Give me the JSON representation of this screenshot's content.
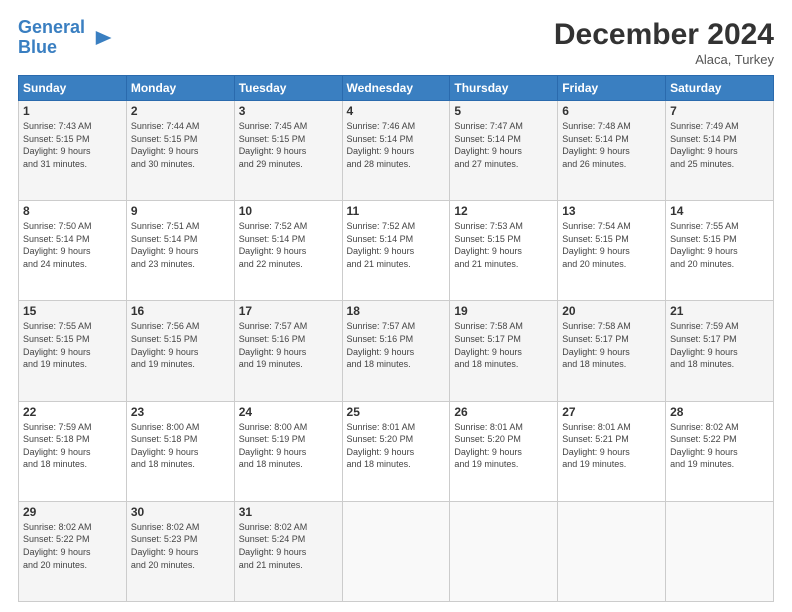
{
  "logo": {
    "line1": "General",
    "line2": "Blue"
  },
  "title": "December 2024",
  "location": "Alaca, Turkey",
  "days_header": [
    "Sunday",
    "Monday",
    "Tuesday",
    "Wednesday",
    "Thursday",
    "Friday",
    "Saturday"
  ],
  "weeks": [
    [
      {
        "day": "1",
        "content": "Sunrise: 7:43 AM\nSunset: 5:15 PM\nDaylight: 9 hours\nand 31 minutes."
      },
      {
        "day": "2",
        "content": "Sunrise: 7:44 AM\nSunset: 5:15 PM\nDaylight: 9 hours\nand 30 minutes."
      },
      {
        "day": "3",
        "content": "Sunrise: 7:45 AM\nSunset: 5:15 PM\nDaylight: 9 hours\nand 29 minutes."
      },
      {
        "day": "4",
        "content": "Sunrise: 7:46 AM\nSunset: 5:14 PM\nDaylight: 9 hours\nand 28 minutes."
      },
      {
        "day": "5",
        "content": "Sunrise: 7:47 AM\nSunset: 5:14 PM\nDaylight: 9 hours\nand 27 minutes."
      },
      {
        "day": "6",
        "content": "Sunrise: 7:48 AM\nSunset: 5:14 PM\nDaylight: 9 hours\nand 26 minutes."
      },
      {
        "day": "7",
        "content": "Sunrise: 7:49 AM\nSunset: 5:14 PM\nDaylight: 9 hours\nand 25 minutes."
      }
    ],
    [
      {
        "day": "8",
        "content": "Sunrise: 7:50 AM\nSunset: 5:14 PM\nDaylight: 9 hours\nand 24 minutes."
      },
      {
        "day": "9",
        "content": "Sunrise: 7:51 AM\nSunset: 5:14 PM\nDaylight: 9 hours\nand 23 minutes."
      },
      {
        "day": "10",
        "content": "Sunrise: 7:52 AM\nSunset: 5:14 PM\nDaylight: 9 hours\nand 22 minutes."
      },
      {
        "day": "11",
        "content": "Sunrise: 7:52 AM\nSunset: 5:14 PM\nDaylight: 9 hours\nand 21 minutes."
      },
      {
        "day": "12",
        "content": "Sunrise: 7:53 AM\nSunset: 5:15 PM\nDaylight: 9 hours\nand 21 minutes."
      },
      {
        "day": "13",
        "content": "Sunrise: 7:54 AM\nSunset: 5:15 PM\nDaylight: 9 hours\nand 20 minutes."
      },
      {
        "day": "14",
        "content": "Sunrise: 7:55 AM\nSunset: 5:15 PM\nDaylight: 9 hours\nand 20 minutes."
      }
    ],
    [
      {
        "day": "15",
        "content": "Sunrise: 7:55 AM\nSunset: 5:15 PM\nDaylight: 9 hours\nand 19 minutes."
      },
      {
        "day": "16",
        "content": "Sunrise: 7:56 AM\nSunset: 5:15 PM\nDaylight: 9 hours\nand 19 minutes."
      },
      {
        "day": "17",
        "content": "Sunrise: 7:57 AM\nSunset: 5:16 PM\nDaylight: 9 hours\nand 19 minutes."
      },
      {
        "day": "18",
        "content": "Sunrise: 7:57 AM\nSunset: 5:16 PM\nDaylight: 9 hours\nand 18 minutes."
      },
      {
        "day": "19",
        "content": "Sunrise: 7:58 AM\nSunset: 5:17 PM\nDaylight: 9 hours\nand 18 minutes."
      },
      {
        "day": "20",
        "content": "Sunrise: 7:58 AM\nSunset: 5:17 PM\nDaylight: 9 hours\nand 18 minutes."
      },
      {
        "day": "21",
        "content": "Sunrise: 7:59 AM\nSunset: 5:17 PM\nDaylight: 9 hours\nand 18 minutes."
      }
    ],
    [
      {
        "day": "22",
        "content": "Sunrise: 7:59 AM\nSunset: 5:18 PM\nDaylight: 9 hours\nand 18 minutes."
      },
      {
        "day": "23",
        "content": "Sunrise: 8:00 AM\nSunset: 5:18 PM\nDaylight: 9 hours\nand 18 minutes."
      },
      {
        "day": "24",
        "content": "Sunrise: 8:00 AM\nSunset: 5:19 PM\nDaylight: 9 hours\nand 18 minutes."
      },
      {
        "day": "25",
        "content": "Sunrise: 8:01 AM\nSunset: 5:20 PM\nDaylight: 9 hours\nand 18 minutes."
      },
      {
        "day": "26",
        "content": "Sunrise: 8:01 AM\nSunset: 5:20 PM\nDaylight: 9 hours\nand 19 minutes."
      },
      {
        "day": "27",
        "content": "Sunrise: 8:01 AM\nSunset: 5:21 PM\nDaylight: 9 hours\nand 19 minutes."
      },
      {
        "day": "28",
        "content": "Sunrise: 8:02 AM\nSunset: 5:22 PM\nDaylight: 9 hours\nand 19 minutes."
      }
    ],
    [
      {
        "day": "29",
        "content": "Sunrise: 8:02 AM\nSunset: 5:22 PM\nDaylight: 9 hours\nand 20 minutes."
      },
      {
        "day": "30",
        "content": "Sunrise: 8:02 AM\nSunset: 5:23 PM\nDaylight: 9 hours\nand 20 minutes."
      },
      {
        "day": "31",
        "content": "Sunrise: 8:02 AM\nSunset: 5:24 PM\nDaylight: 9 hours\nand 21 minutes."
      },
      {
        "day": "",
        "content": ""
      },
      {
        "day": "",
        "content": ""
      },
      {
        "day": "",
        "content": ""
      },
      {
        "day": "",
        "content": ""
      }
    ]
  ]
}
